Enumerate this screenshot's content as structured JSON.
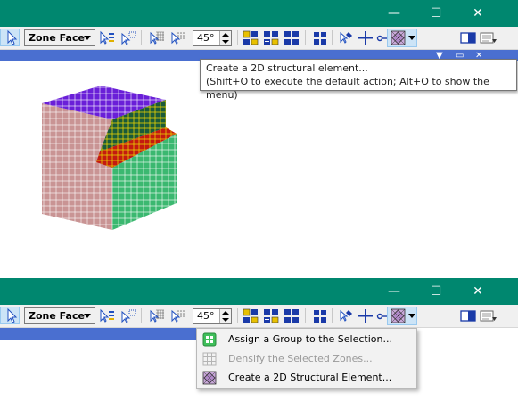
{
  "window": {
    "minimize_glyph": "—",
    "maximize_glyph": "☐",
    "close_glyph": "✕"
  },
  "toolbar": {
    "zone_mode": "Zone Face",
    "angle_value": "45°"
  },
  "tooltip": {
    "line1": "Create a 2D structural element...",
    "line2": "(Shift+O to execute the default action; Alt+O to show the menu)"
  },
  "menu": {
    "items": [
      {
        "label": "Assign a Group to the Selection...",
        "enabled": true,
        "icon": "group-assign-icon"
      },
      {
        "label": "Densify the Selected Zones...",
        "enabled": false,
        "icon": "densify-grid-icon"
      },
      {
        "label": "Create a 2D Structural Element...",
        "enabled": true,
        "icon": "structural-element-icon"
      }
    ]
  },
  "colors": {
    "titlebar": "#00876f",
    "viewport_header": "#4a6fd0",
    "cube_top": "#6a1fd8",
    "cube_step": "#1a5a3a",
    "cube_hilite": "#d0b800",
    "cube_left": "#c99494",
    "cube_front": "#3bb870",
    "cube_red": "#c41a10"
  }
}
